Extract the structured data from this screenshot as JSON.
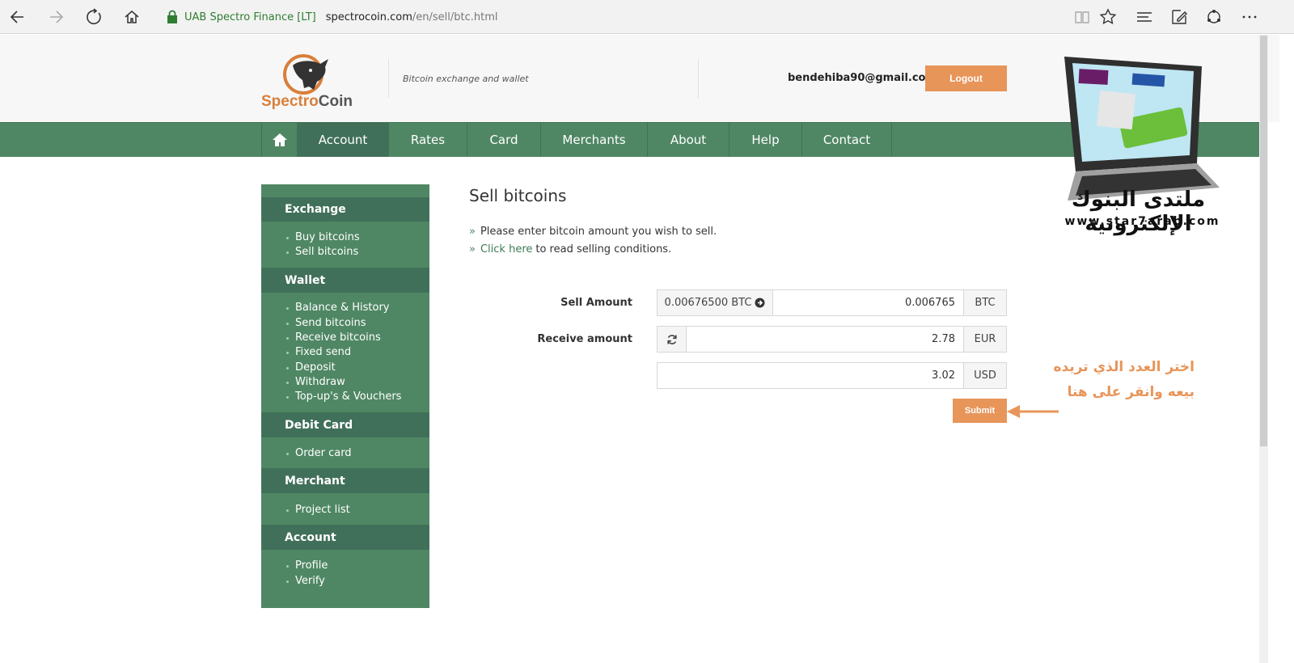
{
  "browser": {
    "site_identity": "UAB Spectro Finance [LT]",
    "url_host": "spectrocoin.com",
    "url_path": "/en/sell/btc.html"
  },
  "header": {
    "logo_part1": "Spectro",
    "logo_part2": "Coin",
    "tagline": "Bitcoin exchange and wallet",
    "user_email": "bendehiba90@gmail.com",
    "logout_label": "Logout"
  },
  "nav": {
    "items": [
      "Account",
      "Rates",
      "Card",
      "Merchants",
      "About",
      "Help",
      "Contact"
    ],
    "active": "Account"
  },
  "sidebar": {
    "sections": [
      {
        "title": "Exchange",
        "links": [
          "Buy bitcoins",
          "Sell bitcoins"
        ]
      },
      {
        "title": "Wallet",
        "links": [
          "Balance & History",
          "Send bitcoins",
          "Receive bitcoins",
          "Fixed send",
          "Deposit",
          "Withdraw",
          "Top-up's & Vouchers"
        ]
      },
      {
        "title": "Debit Card",
        "links": [
          "Order card"
        ]
      },
      {
        "title": "Merchant",
        "links": [
          "Project list"
        ]
      },
      {
        "title": "Account",
        "links": [
          "Profile",
          "Verify"
        ]
      }
    ]
  },
  "main": {
    "title": "Sell bitcoins",
    "info1": "Please enter bitcoin amount you wish to sell.",
    "info2_link": "Click here",
    "info2_rest": "to read selling conditions.",
    "sell_amount_label": "Sell Amount",
    "sell_max_btn": "0.00676500 BTC",
    "sell_value": "0.006765",
    "sell_unit": "BTC",
    "receive_label": "Receive amount",
    "receive_eur_value": "2.78",
    "receive_eur_unit": "EUR",
    "receive_usd_value": "3.02",
    "receive_usd_unit": "USD",
    "submit_label": "Submit"
  },
  "overlay": {
    "brand_arabic": "ملتدى البنوك الإلكترونية",
    "brand_url": "www.star7arab.com",
    "annotation_line1": "اختر العدد الذي تريده",
    "annotation_line2": "بيعه وانقر على هنا"
  },
  "colors": {
    "nav_green": "#4f8764",
    "nav_green_dark": "#41705a",
    "accent_orange": "#e8955a"
  }
}
